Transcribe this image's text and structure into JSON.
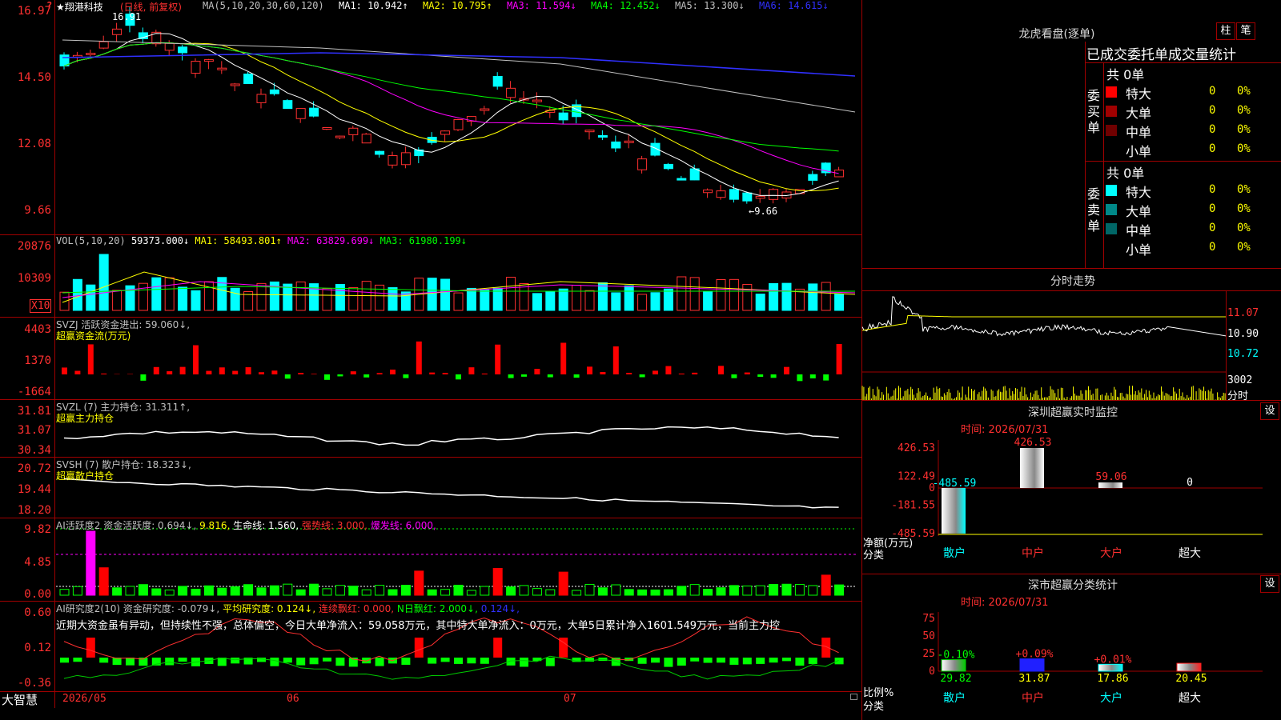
{
  "app": {
    "brand": "大智慧",
    "alert_mark": "?"
  },
  "k": {
    "stock_name": "★翔港科技",
    "period": "(日线, 前复权)",
    "ma_label": "MA(5,10,20,30,60,120)",
    "ma": [
      {
        "label": "MA1: 10.942↑",
        "color": "#ffffff"
      },
      {
        "label": "MA2: 10.795↑",
        "color": "#ffff00"
      },
      {
        "label": "MA3: 11.594↓",
        "color": "#ff00ff"
      },
      {
        "label": "MA4: 12.452↓",
        "color": "#00ff00"
      },
      {
        "label": "MA5: 13.300↓",
        "color": "#c0c0c0"
      },
      {
        "label": "MA6: 14.615↓",
        "color": "#3030ff"
      }
    ],
    "y_labels": [
      "16.97",
      "14.50",
      "12.08",
      "9.66"
    ],
    "high_marker": "16.91",
    "low_marker": "←9.66"
  },
  "vol": {
    "title": "VOL(5,10,20)",
    "value": "59373.000↓",
    "ma": [
      {
        "label": "MA1: 58493.801↑",
        "color": "#ffff00"
      },
      {
        "label": "MA2: 63829.699↓",
        "color": "#ff00ff"
      },
      {
        "label": "MA3: 61980.199↓",
        "color": "#00ff00"
      }
    ],
    "y_labels": [
      "20876",
      "10309"
    ],
    "unit": "X10"
  },
  "svzj": {
    "title": "SVZJ  活跃资金进出: 59.060↓,",
    "sub": "超赢资金流(万元)",
    "y_labels": [
      "4403",
      "1370",
      "-1664"
    ]
  },
  "svzl": {
    "title": "SVZL (7) 主力持仓: 31.311↑,",
    "sub": "超赢主力持仓",
    "y_labels": [
      "31.81",
      "31.07",
      "30.34"
    ]
  },
  "svsh": {
    "title": "SVSH (7) 散户持仓: 18.323↓,",
    "sub": "超赢散户持仓",
    "y_labels": [
      "20.72",
      "19.44",
      "18.20"
    ]
  },
  "ai1": {
    "title": "AI活跃度2 资金活跃度: 0.694↓,",
    "v2": "9.816,",
    "v3": "生命线: 1.560,",
    "v4": "强势线: 3.000,",
    "v5": "爆发线: 6.000,",
    "y_labels": [
      "9.82",
      "4.85",
      "0.00"
    ]
  },
  "ai2": {
    "title": "AI研究度2(10) 资金研究度: -0.079↓,",
    "v2": "平均研究度: 0.124↓,",
    "v3": "连续飘红: 0.000,",
    "v4": "N日飘红: 2.000↓,",
    "v5": "0.124↓,",
    "y_labels": [
      "0.60",
      "0.12",
      "-0.36"
    ],
    "comment": "近期大资金虽有异动，但持续性不强，总体偏空，今日大单净流入：59.058万元，其中特大单净流入：0万元，大单5日累计净入1601.549万元，当前主力控"
  },
  "x_axis": {
    "labels": [
      "2026/05",
      "06",
      "07"
    ]
  },
  "dragon": {
    "title": "龙虎看盘(逐单)",
    "btn_bar": "柱",
    "btn_pen": "笔",
    "header": "已成交委托单成交量统计",
    "buy": {
      "side": "委买单",
      "count": "共 0单",
      "rows": [
        {
          "label": "特大",
          "num": "0",
          "pct": "0%",
          "color": "#ff0000"
        },
        {
          "label": "大单",
          "num": "0",
          "pct": "0%",
          "color": "#a00000"
        },
        {
          "label": "中单",
          "num": "0",
          "pct": "0%",
          "color": "#700000"
        },
        {
          "label": "小单",
          "num": "0",
          "pct": "0%",
          "color": "#000000"
        }
      ]
    },
    "sell": {
      "side": "委卖单",
      "count": "共 0单",
      "rows": [
        {
          "label": "特大",
          "num": "0",
          "pct": "0%",
          "color": "#00ffff"
        },
        {
          "label": "大单",
          "num": "0",
          "pct": "0%",
          "color": "#008888"
        },
        {
          "label": "中单",
          "num": "0",
          "pct": "0%",
          "color": "#006666"
        },
        {
          "label": "小单",
          "num": "0",
          "pct": "0%",
          "color": "#000000"
        }
      ]
    }
  },
  "intraday": {
    "title": "分时走势",
    "prices": [
      "11.07",
      "10.90",
      "10.72"
    ],
    "vol_top": "3002",
    "vol_unit": "分时"
  },
  "sz_monitor": {
    "title": "深圳超赢实时监控",
    "btn": "设",
    "time": "时间: 2026/07/31",
    "y_labels": [
      "426.53",
      "122.49",
      "0",
      "-181.55",
      "-485.59"
    ],
    "axis_title": "净额(万元)",
    "cat_label": "分类",
    "bars": [
      {
        "name": "散户",
        "value": -485.59,
        "label": "-485.59"
      },
      {
        "name": "中户",
        "value": 426.53,
        "label": "426.53"
      },
      {
        "name": "大户",
        "value": 59.06,
        "label": "59.06"
      },
      {
        "name": "超大",
        "value": 0,
        "label": "0"
      }
    ]
  },
  "sh_stats": {
    "title": "深市超赢分类统计",
    "btn": "设",
    "time": "时间: 2026/07/31",
    "y_labels": [
      "75",
      "50",
      "25",
      "0"
    ],
    "axis_title": "比例%",
    "cat_label": "分类",
    "bars": [
      {
        "name": "散户",
        "value": 29.82,
        "label": "29.82",
        "delta": "-0.10%",
        "color": "#00cc00"
      },
      {
        "name": "中户",
        "value": 31.87,
        "label": "31.87",
        "delta": "+0.09%",
        "color": "#2020ff"
      },
      {
        "name": "大户",
        "value": 17.86,
        "label": "17.86",
        "delta": "+0.01%",
        "color": "#00ffff"
      },
      {
        "name": "超大",
        "value": 20.45,
        "label": "20.45",
        "delta": "",
        "color": "#ff2020"
      }
    ]
  }
}
